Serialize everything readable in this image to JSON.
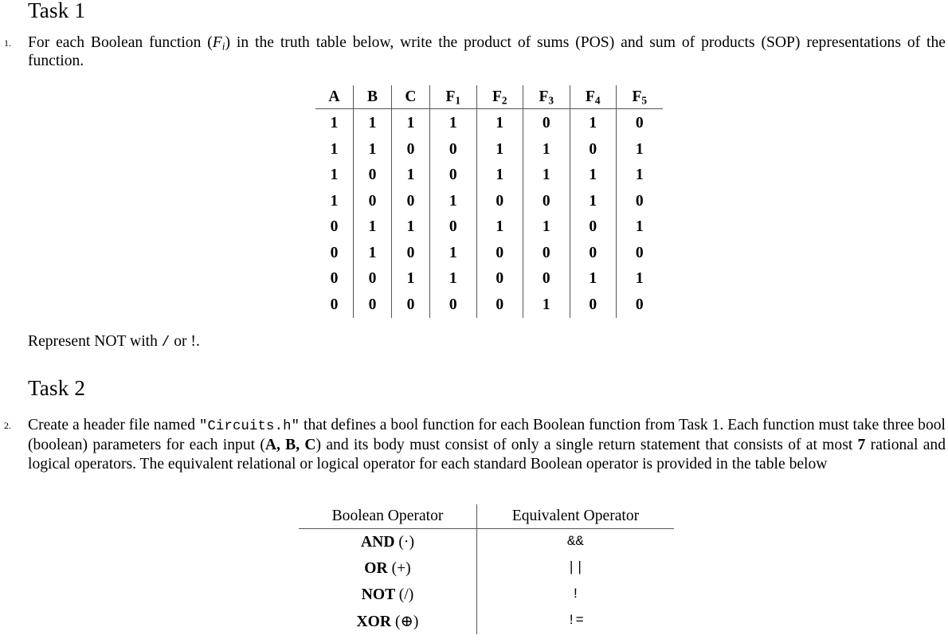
{
  "document": {
    "task1": {
      "heading": "Task 1",
      "item_marker": "1.",
      "text_part1": "For each Boolean function (",
      "text_fi": "F",
      "text_fi_sub": "i",
      "text_part2": ") in the truth table below, write the product of sums (POS) and sum of products (SOP) representations of the function.",
      "note_prefix": "Represent NOT with ",
      "note_symbol": "/",
      "note_suffix": " or !."
    },
    "truth_table": {
      "headers": [
        {
          "label": "A",
          "sub": ""
        },
        {
          "label": "B",
          "sub": ""
        },
        {
          "label": "C",
          "sub": ""
        },
        {
          "label": "F",
          "sub": "1"
        },
        {
          "label": "F",
          "sub": "2"
        },
        {
          "label": "F",
          "sub": "3"
        },
        {
          "label": "F",
          "sub": "4"
        },
        {
          "label": "F",
          "sub": "5"
        }
      ],
      "rows": [
        [
          "1",
          "1",
          "1",
          "1",
          "1",
          "0",
          "1",
          "0"
        ],
        [
          "1",
          "1",
          "0",
          "0",
          "1",
          "1",
          "0",
          "1"
        ],
        [
          "1",
          "0",
          "1",
          "0",
          "1",
          "1",
          "1",
          "1"
        ],
        [
          "1",
          "0",
          "0",
          "1",
          "0",
          "0",
          "1",
          "0"
        ],
        [
          "0",
          "1",
          "1",
          "0",
          "1",
          "1",
          "0",
          "1"
        ],
        [
          "0",
          "1",
          "0",
          "1",
          "0",
          "0",
          "0",
          "0"
        ],
        [
          "0",
          "0",
          "1",
          "1",
          "0",
          "0",
          "1",
          "1"
        ],
        [
          "0",
          "0",
          "0",
          "0",
          "0",
          "1",
          "0",
          "0"
        ]
      ]
    },
    "task2": {
      "heading": "Task 2",
      "item_marker": "2.",
      "text_part1": "Create a header file named ",
      "filename": "\"Circuits.h\"",
      "text_part2": " that defines a bool function for each Boolean function from Task 1. Each function must take three bool (boolean) parameters for each input (",
      "inputs_bold": "A, B, C",
      "text_part3": ") and its body must consist of only a single return statement that consists of at most ",
      "operator_count": "7",
      "text_part4": " rational and logical operators. The equivalent relational or logical operator for each standard Boolean operator is provided in the table below"
    },
    "operator_table": {
      "header_left": "Boolean Operator",
      "header_right": "Equivalent Operator",
      "rows": [
        {
          "name": "AND",
          "symbol": "(·)",
          "equivalent": "&&"
        },
        {
          "name": "OR",
          "symbol": "(+)",
          "equivalent": "||"
        },
        {
          "name": "NOT",
          "symbol": "(/)",
          "equivalent": "!"
        },
        {
          "name": "XOR",
          "symbol": "(⊕)",
          "equivalent": "!="
        }
      ]
    }
  },
  "colors": {
    "text": "#000000",
    "rule": "#555555",
    "background": "#ffffff"
  }
}
